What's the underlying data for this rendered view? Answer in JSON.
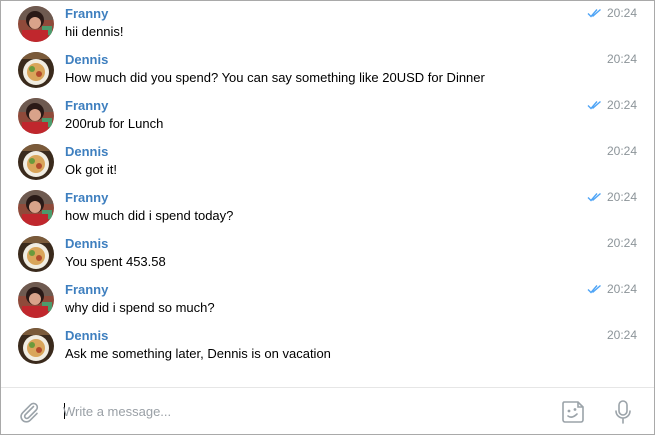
{
  "messages": [
    {
      "sender": "Franny",
      "text": "hii dennis!",
      "time": "20:24",
      "read": true,
      "avatar": "franny"
    },
    {
      "sender": "Dennis",
      "text": "How much did you spend? You can say something like 20USD for Dinner",
      "time": "20:24",
      "read": false,
      "avatar": "dennis"
    },
    {
      "sender": "Franny",
      "text": "200rub for Lunch",
      "time": "20:24",
      "read": true,
      "avatar": "franny"
    },
    {
      "sender": "Dennis",
      "text": "Ok got it!",
      "time": "20:24",
      "read": false,
      "avatar": "dennis"
    },
    {
      "sender": "Franny",
      "text": "how much did i spend today?",
      "time": "20:24",
      "read": true,
      "avatar": "franny"
    },
    {
      "sender": "Dennis",
      "text": "You spent 453.58",
      "time": "20:24",
      "read": false,
      "avatar": "dennis"
    },
    {
      "sender": "Franny",
      "text": "why did i spend so much?",
      "time": "20:24",
      "read": true,
      "avatar": "franny"
    },
    {
      "sender": "Dennis",
      "text": "Ask me something later, Dennis is on vacation",
      "time": "20:24",
      "read": false,
      "avatar": "dennis"
    }
  ],
  "composer": {
    "placeholder": "Write a message...",
    "value": "",
    "icons": {
      "attach": "paperclip-icon",
      "emoji": "sticker-emoji-icon",
      "voice": "microphone-icon"
    }
  },
  "colors": {
    "sender": "#3e7fbf",
    "read_check": "#4ea4f6",
    "time": "#8c9499"
  }
}
